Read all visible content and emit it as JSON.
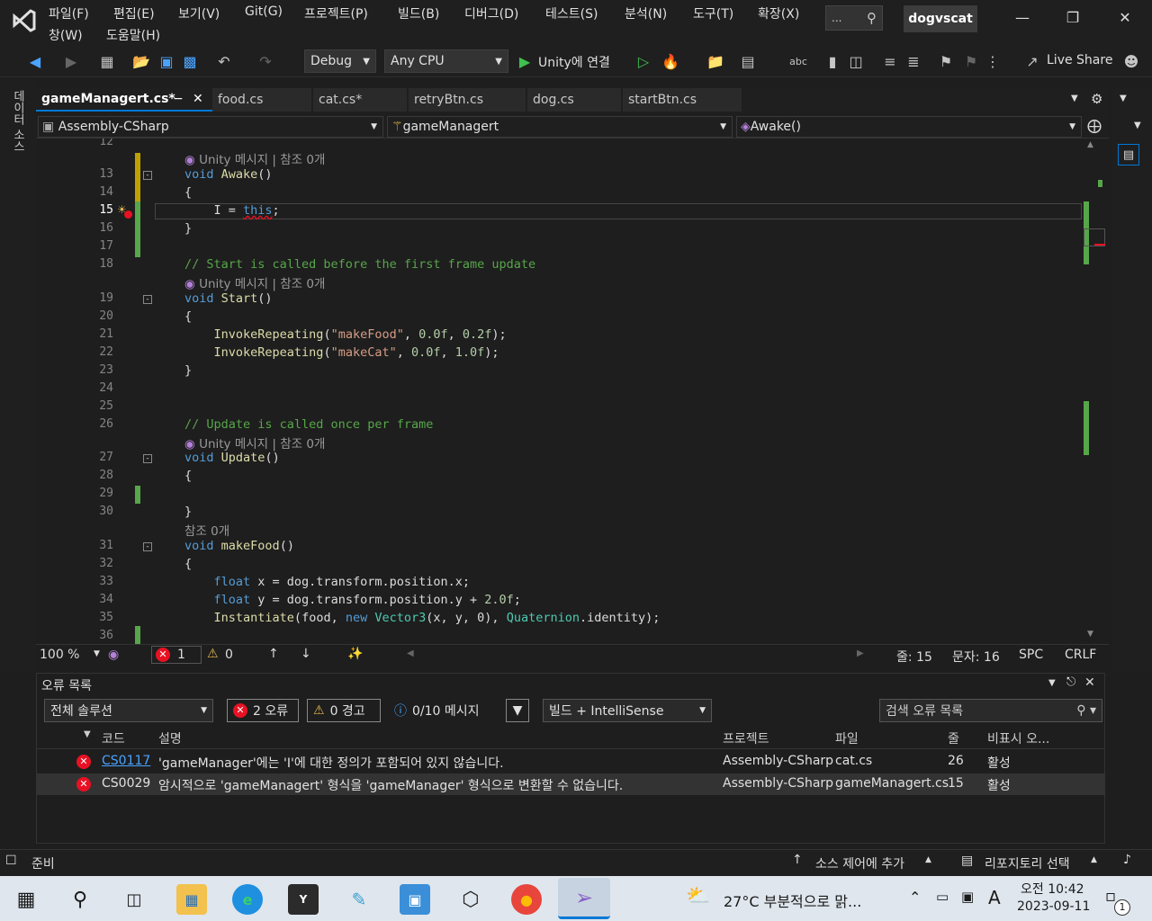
{
  "menu": {
    "items": [
      "파일(F)",
      "편집(E)",
      "보기(V)",
      "Git(G)",
      "프로젝트(P)",
      "빌드(B)",
      "디버그(D)",
      "테스트(S)",
      "분석(N)",
      "도구(T)",
      "확장(X)",
      "창(W)",
      "도움말(H)"
    ],
    "search_label": "...",
    "solution_name": "dogvscat"
  },
  "toolbar": {
    "config": "Debug",
    "platform": "Any CPU",
    "run_label": "Unity에 연결",
    "live_share": "Live Share"
  },
  "side_left_label": "데이터 소스",
  "tabs": [
    "gameManagert.cs*",
    "food.cs",
    "cat.cs*",
    "retryBtn.cs",
    "dog.cs",
    "startBtn.cs"
  ],
  "nav": {
    "project": "Assembly-CSharp",
    "class": "gameManagert",
    "member": "Awake()"
  },
  "code": {
    "codelens_unity": "Unity 메시지 | 참조 0개",
    "codelens_ref": "참조 0개",
    "lines": {
      "l12": "12",
      "l13": "13",
      "l14": "14",
      "l15": "15",
      "l16": "16",
      "l17": "17",
      "l18": "18",
      "l19": "19",
      "l20": "20",
      "l21": "21",
      "l22": "22",
      "l23": "23",
      "l24": "24",
      "l25": "25",
      "l26": "26",
      "l27": "27",
      "l28": "28",
      "l29": "29",
      "l30": "30",
      "l31": "31",
      "l32": "32",
      "l33": "33",
      "l34": "34",
      "l35": "35",
      "l36": "36"
    },
    "comment_start": "// Start is called before the first frame update",
    "comment_update": "// Update is called once per frame",
    "tok": {
      "void": "void",
      "awake": "Awake",
      "parens": "()",
      "brace_open": "{",
      "brace_close": "}",
      "l_assign": "I = ",
      "this": "this",
      "semi": ";",
      "start": "Start",
      "invoke": "InvokeRepeating",
      "open_paren": "(",
      "make_food_str": "\"makeFood\"",
      "make_cat_str": "\"makeCat\"",
      "comma_space": ", ",
      "n00f": "0.0f",
      "n02f": "0.2f",
      "n10f": "1.0f",
      "close_semi": ");",
      "update": "Update",
      "makefood": "makeFood",
      "float": "float",
      "x_assign": " x = ",
      "y_assign": " y = ",
      "dog_pos_x": "dog.transform.position.x;",
      "dog_pos_y": "dog.transform.position.y + ",
      "n20f": "2.0f",
      "instantiate": "Instantiate",
      "food_arg": "food, ",
      "new": "new",
      "vector3": "Vector3",
      "xy0": "(x, y, 0), ",
      "quaternion": "Quaternion",
      "identity": ".identity);"
    }
  },
  "editor_status": {
    "zoom": "100 %",
    "errors": "1",
    "warnings": "0",
    "line": "줄: 15",
    "col": "문자: 16",
    "spc": "SPC",
    "crlf": "CRLF"
  },
  "error_list": {
    "title": "오류 목록",
    "scope": "전체 솔루션",
    "errors_btn": "2 오류",
    "warnings_btn": "0 경고",
    "messages_btn": "0/10 메시지",
    "build_filter": "빌드 + IntelliSense",
    "search_placeholder": "검색 오류 목록",
    "columns": {
      "code": "코드",
      "desc": "설명",
      "project": "프로젝트",
      "file": "파일",
      "line": "줄",
      "suppress": "비표시 오..."
    },
    "rows": [
      {
        "code": "CS0117",
        "desc": "'gameManager'에는 'I'에 대한 정의가 포함되어 있지 않습니다.",
        "project": "Assembly-CSharp",
        "file": "cat.cs",
        "line": "26",
        "state": "활성"
      },
      {
        "code": "CS0029",
        "desc": "암시적으로 'gameManagert' 형식을 'gameManager' 형식으로 변환할 수 없습니다.",
        "project": "Assembly-CSharp",
        "file": "gameManagert.cs",
        "line": "15",
        "state": "활성"
      }
    ]
  },
  "status_bar": {
    "ready": "준비",
    "source_control": "소스 제어에 추가",
    "repo": "리포지토리 선택"
  },
  "taskbar": {
    "weather": "27°C  부분적으로 맑...",
    "time": "오전 10:42",
    "date": "2023-09-11",
    "ime": "A",
    "notif": "1",
    "app_y": "Y"
  },
  "colors": {
    "accent": "#0078d4",
    "error": "#e81123",
    "vs_purple": "#8661c5"
  }
}
